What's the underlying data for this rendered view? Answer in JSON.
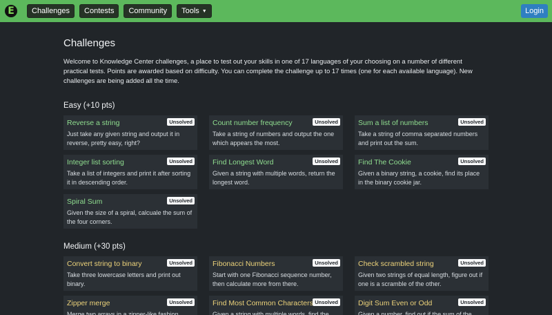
{
  "nav": {
    "logo": "E",
    "items": [
      "Challenges",
      "Contests",
      "Community"
    ],
    "tools_label": "Tools",
    "login_label": "Login"
  },
  "page": {
    "title": "Challenges",
    "intro": "Welcome to Knowledge Center challenges, a place to test out your skills in one of 17 languages of your choosing on a number of different practical tests. Points are awarded based on difficulty. You can complete the challenge up to 17 times (one for each available language). New challenges are being added all the time."
  },
  "sections": [
    {
      "heading": "Easy (+10 pts)",
      "challenges": [
        {
          "title": "Reverse a string",
          "desc": "Just take any given string and output it in reverse, pretty easy, right?",
          "status": "Unsolved"
        },
        {
          "title": "Count number frequency",
          "desc": "Take a string of numbers and output the one which appears the most.",
          "status": "Unsolved"
        },
        {
          "title": "Sum a list of numbers",
          "desc": "Take a string of comma separated numbers and print out the sum.",
          "status": "Unsolved"
        },
        {
          "title": "Integer list sorting",
          "desc": "Take a list of integers and print it after sorting it in descending order.",
          "status": "Unsolved"
        },
        {
          "title": "Find Longest Word",
          "desc": "Given a string with multiple words, return the longest word.",
          "status": "Unsolved"
        },
        {
          "title": "Find The Cookie",
          "desc": "Given a binary string, a cookie, find its place in the binary cookie jar.",
          "status": "Unsolved"
        },
        {
          "title": "Spiral Sum",
          "desc": "Given the size of a spiral, calcuale the sum of the four corners.",
          "status": "Unsolved"
        }
      ]
    },
    {
      "heading": "Medium (+30 pts)",
      "challenges": [
        {
          "title": "Convert string to binary",
          "desc": "Take three lowercase letters and print out binary.",
          "status": "Unsolved"
        },
        {
          "title": "Fibonacci Numbers",
          "desc": "Start with one Fibonacci sequence number, then calculate more from there.",
          "status": "Unsolved"
        },
        {
          "title": "Check scrambled string",
          "desc": "Given two strings of equal length, figure out if one is a scramble of the other.",
          "status": "Unsolved"
        },
        {
          "title": "Zipper merge",
          "desc": "Merge two arrays in a zipper-like fashion.",
          "status": "Unsolved"
        },
        {
          "title": "Find Most Common Characters",
          "desc": "Given a string with multiple words, find the most common character.",
          "status": "Unsolved"
        },
        {
          "title": "Digit Sum Even or Odd",
          "desc": "Given a number, find out if the sum of the digits is even or odd.",
          "status": "Unsolved"
        }
      ]
    }
  ]
}
